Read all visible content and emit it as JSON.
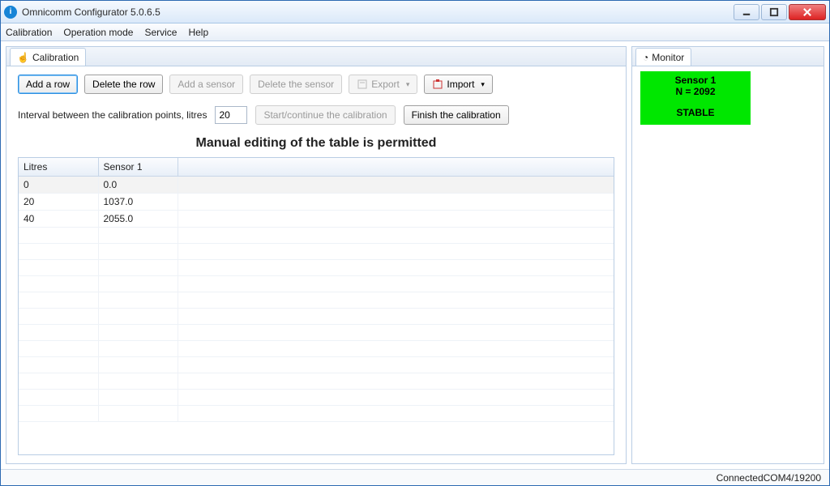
{
  "window": {
    "title": "Omnicomm Configurator 5.0.6.5"
  },
  "menubar": {
    "items": [
      "Calibration",
      "Operation mode",
      "Service",
      "Help"
    ]
  },
  "left": {
    "tab_label": "Calibration",
    "toolbar": {
      "add_row": "Add a row",
      "delete_row": "Delete the row",
      "add_sensor": "Add a sensor",
      "delete_sensor": "Delete the sensor",
      "export": "Export",
      "import": "Import"
    },
    "interval": {
      "label": "Interval between the calibration points, litres",
      "value": "20",
      "start_continue": "Start/continue the calibration",
      "finish": "Finish the calibration"
    },
    "heading": "Manual editing of the table is permitted",
    "table": {
      "columns": [
        "Litres",
        "Sensor 1"
      ],
      "rows": [
        {
          "litres": "0",
          "sensor1": "0.0"
        },
        {
          "litres": "20",
          "sensor1": "1037.0"
        },
        {
          "litres": "40",
          "sensor1": "2055.0"
        }
      ]
    }
  },
  "right": {
    "tab_label": "Monitor",
    "sensor": {
      "name": "Sensor 1",
      "n_label": "N = 2092",
      "status": "STABLE"
    }
  },
  "statusbar": {
    "text": "ConnectedCOM4/19200"
  }
}
